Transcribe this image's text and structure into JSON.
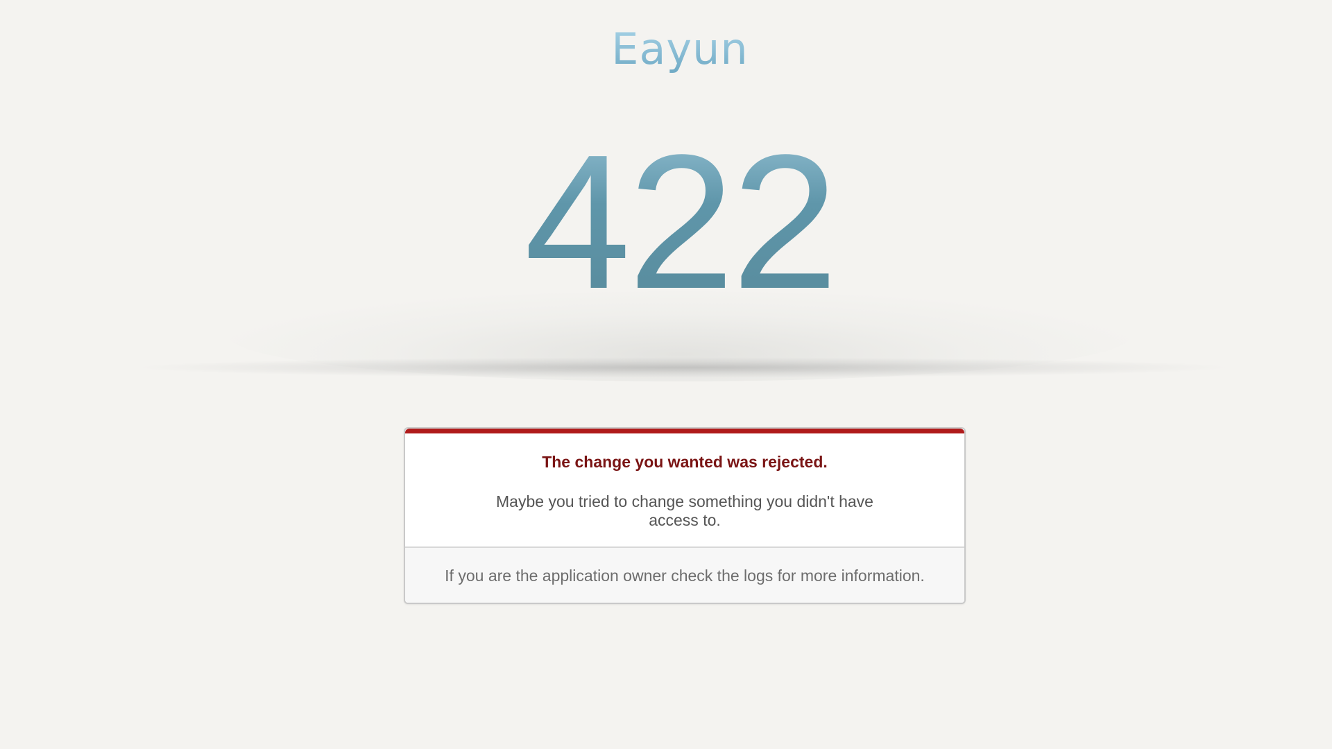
{
  "brand": {
    "name": "Eayun"
  },
  "error": {
    "code": "422",
    "title": "The change you wanted was rejected.",
    "description": "Maybe you tried to change something you didn't have access to.",
    "footer": "If you are the application owner check the logs for more information."
  },
  "colors": {
    "background": "#f4f3f0",
    "accent_bar": "#b01b1b",
    "title_text": "#7a1414",
    "code_color": "#5f96aa",
    "brand_color": "#8fc3dc"
  }
}
